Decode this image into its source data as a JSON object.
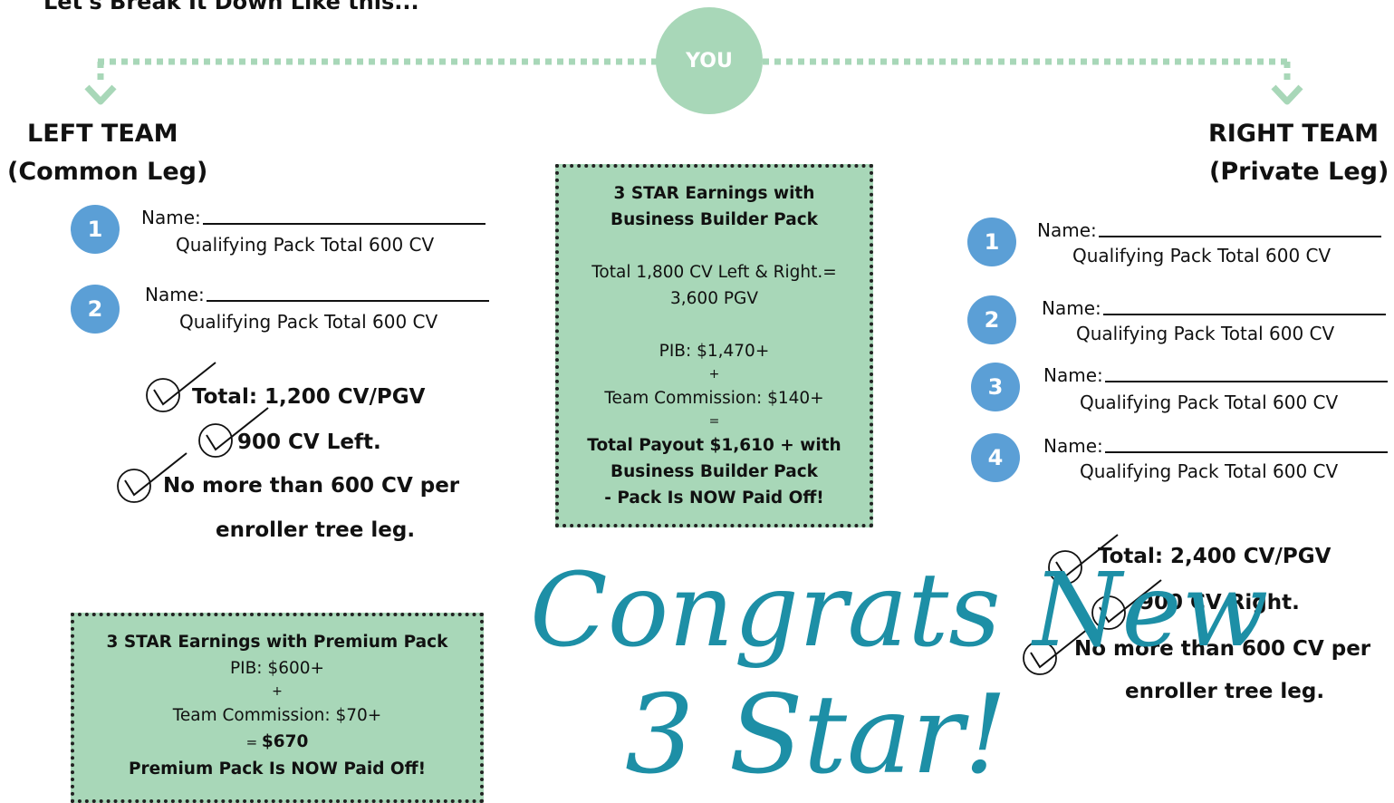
{
  "heading": "Let's Break It Down Like this...",
  "you_label": "YOU",
  "left": {
    "title1": "LEFT TEAM",
    "title2": "(Common Leg)",
    "members": [
      {
        "num": "1",
        "name_label": "Name:",
        "qual": "Qualifying Pack Total 600 CV"
      },
      {
        "num": "2",
        "name_label": "Name:",
        "qual": "Qualifying Pack Total 600 CV"
      }
    ],
    "checks": [
      "Total: 1,200 CV/PGV",
      "900 CV Left.",
      "No more than 600 CV per"
    ],
    "checks_cont": "enroller tree leg."
  },
  "right": {
    "title1": "RIGHT TEAM",
    "title2": "(Private Leg)",
    "members": [
      {
        "num": "1",
        "name_label": "Name:",
        "qual": "Qualifying Pack Total 600 CV"
      },
      {
        "num": "2",
        "name_label": "Name:",
        "qual": "Qualifying Pack Total 600 CV"
      },
      {
        "num": "3",
        "name_label": "Name:",
        "qual": "Qualifying Pack Total 600 CV"
      },
      {
        "num": "4",
        "name_label": "Name:",
        "qual": "Qualifying Pack Total 600 CV"
      }
    ],
    "checks": [
      "Total: 2,400 CV/PGV",
      "900 CV Right.",
      "No more than 600 CV per"
    ],
    "checks_cont": "enroller tree leg."
  },
  "center_box": {
    "title1": "3 STAR Earnings with",
    "title2": "Business Builder Pack",
    "line1": "Total 1,800 CV Left & Right.=",
    "line2": "3,600 PGV",
    "pib": "PIB: $1,470+",
    "plus": "+",
    "team": "Team Commission: $140+",
    "equals": "=",
    "total1": "Total Payout $1,610 + with",
    "total2": "Business Builder Pack",
    "total3": "- Pack Is NOW Paid Off!"
  },
  "premium_box": {
    "title": "3 STAR Earnings with Premium Pack",
    "pib": "PIB: $600+",
    "plus": "+",
    "team": "Team Commission: $70+",
    "equals": "= ",
    "amount": "$670",
    "paid": "Premium Pack Is NOW Paid Off!"
  },
  "congrats": {
    "line1": "Congrats New",
    "line2": "3 Star!"
  },
  "colors": {
    "accent_green": "#a8d7b8",
    "number_blue": "#5b9fd6",
    "script_teal": "#1d8fa6"
  }
}
